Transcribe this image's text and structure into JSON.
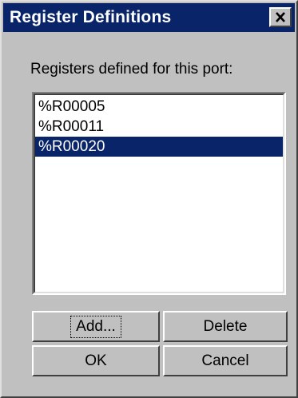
{
  "window": {
    "title": "Register Definitions",
    "close_icon": "close-x-icon"
  },
  "label": "Registers defined for this port:",
  "registers": {
    "items": [
      "%R00005",
      "%R00011",
      "%R00020"
    ],
    "selected_index": 2
  },
  "buttons": {
    "add": "Add...",
    "delete": "Delete",
    "ok": "OK",
    "cancel": "Cancel"
  },
  "colors": {
    "face": "#c0c0c0",
    "titlebar": "#0a246a",
    "selection": "#0a246a"
  }
}
